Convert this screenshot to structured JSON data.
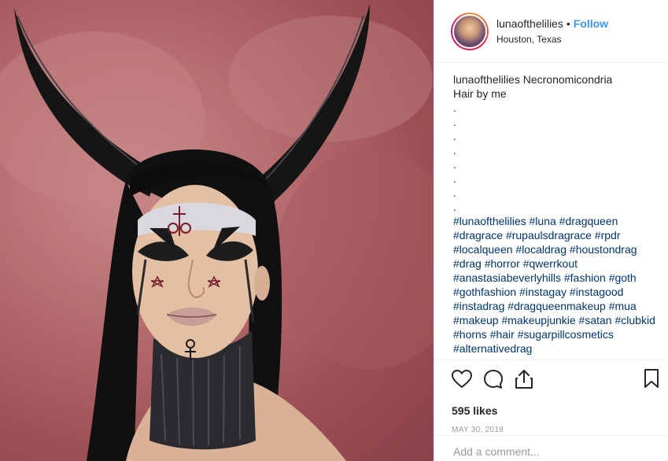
{
  "post": {
    "photo_alt": "Post photo"
  },
  "header": {
    "username": "lunaofthelilies",
    "separator": "•",
    "follow_label": "Follow",
    "location": "Houston, Texas"
  },
  "caption": {
    "username": "lunaofthelilies",
    "title": "Necronomicondria",
    "credit": "Hair by me",
    "dots": [
      ".",
      ".",
      ".",
      ".",
      ".",
      ".",
      ".",
      "."
    ],
    "hashtag_lines": [
      [
        "#lunaofthelilies",
        "#luna",
        "#dragqueen"
      ],
      [
        "#dragrace",
        "#rupaulsdragrace",
        "#rpdr"
      ],
      [
        "#localqueen",
        "#localdrag",
        "#houstondrag"
      ],
      [
        "#drag",
        "#horror",
        "#qwerrkout"
      ],
      [
        "#anastasiabeverlyhills",
        "#fashion",
        "#goth"
      ],
      [
        "#gothfashion",
        "#instagay",
        "#instagood"
      ],
      [
        "#instadrag",
        "#dragqueenmakeup",
        "#mua"
      ],
      [
        "#makeup",
        "#makeupjunkie",
        "#satan",
        "#clubkid"
      ],
      [
        "#horns",
        "#hair",
        "#sugarpillcosmetics"
      ],
      [
        "#alternativedrag"
      ]
    ]
  },
  "actions": {
    "icons": [
      "heart-icon",
      "comment-icon",
      "share-icon",
      "bookmark-icon"
    ],
    "likes": "595 likes",
    "date": "MAY 30, 2018"
  },
  "comment": {
    "placeholder": "Add a comment..."
  },
  "colors": {
    "link": "#3897f0",
    "hashtag": "#003569",
    "muted": "#999999",
    "border": "#efefef"
  }
}
